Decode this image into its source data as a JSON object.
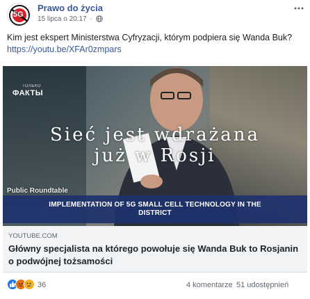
{
  "post": {
    "page_name": "Prawo do życia",
    "date": "15 lipca o 20:17",
    "separator": "·",
    "text_main": "Kim jest ekspert Ministerstwa Cyfryzacji, którym podpiera się Wanda Buk?",
    "text_link": "https://youtu.be/XFAr0zmpars"
  },
  "avatar_label": "5G",
  "video": {
    "channel_logo_small": "ТОЛЬКО",
    "channel_logo": "ФАКТЫ",
    "overlay_line1": "Sieć jest wdrażana",
    "overlay_line2": "już w Rosji",
    "roundtable_label": "Public Roundtable",
    "lower_third_line1": "IMPLEMENTATION OF 5G SMALL CELL TECHNOLOGY IN THE",
    "lower_third_line2": "DISTRICT"
  },
  "link_preview": {
    "domain": "YOUTUBE.COM",
    "title": "Główny specjalista na którego powołuje się Wanda Buk to Rosjanin o podwójnej tożsamości"
  },
  "footer": {
    "reaction_count": "36",
    "comments": "4 komentarze",
    "shares": "51 udostępnień"
  },
  "colors": {
    "link": "#385898",
    "lower_third": "#1e326e",
    "like": "#1877f2",
    "angry": "#e9710f",
    "sad": "#f7b125"
  },
  "icons": [
    "globe-icon",
    "more-options-icon",
    "like-reaction-icon",
    "angry-reaction-icon",
    "sad-reaction-icon"
  ]
}
